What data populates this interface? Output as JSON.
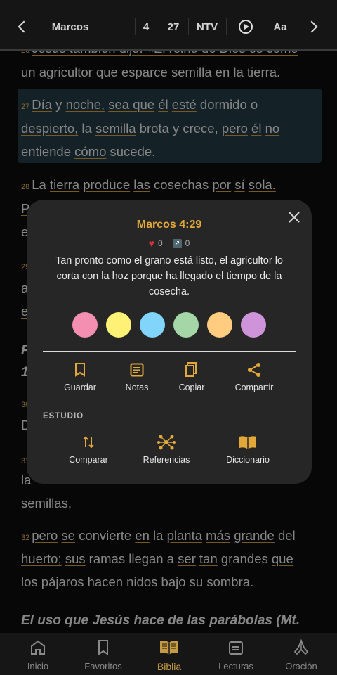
{
  "topbar": {
    "book": "Marcos",
    "chapter": "4",
    "count": "27",
    "version": "NTV",
    "font_label": "Aa"
  },
  "reader": {
    "v26_frag": "26",
    "v26_l1": "Jesús también dijo: «El reino de Dios es como",
    "v26_l2a": "un agricultor ",
    "v26_l2b": "que",
    "v26_l2c": " esparce ",
    "v26_l2d": "semilla",
    "v26_l2e": " ",
    "v26_l2f": "en",
    "v26_l2g": " la ",
    "v26_l2h": "tierra.",
    "v27_num": "27",
    "v27_w1": "Día",
    "v27_w2": " y ",
    "v27_w3": "noche,",
    "v27_w4": " ",
    "v27_w5": "sea que",
    "v27_w6": " ",
    "v27_w7": "él",
    "v27_w8": " ",
    "v27_w9": "esté",
    "v27_w10": " dormido o",
    "v27_l2a": "despierto,",
    "v27_l2b": " la ",
    "v27_l2c": "semilla",
    "v27_l2d": " brota y crece, ",
    "v27_l2e": "pero",
    "v27_l2f": " ",
    "v27_l2g": "él",
    "v27_l2h": " ",
    "v27_l2i": "no",
    "v27_l3a": "entiende ",
    "v27_l3b": "cómo",
    "v27_l3c": " sucede.",
    "v28_num": "28",
    "v28_w1": "La ",
    "v28_w2": "tierra",
    "v28_w3": " ",
    "v28_w4": "produce",
    "v28_w5": " ",
    "v28_w6": "las",
    "v28_w7": " cosechas ",
    "v28_w8": "por",
    "v28_w9": " ",
    "v28_w10": "sí",
    "v28_w11": " ",
    "v28_w12": "sola.",
    "v28_l2": "P",
    "v28_l3": "e",
    "v29_num": "29",
    "v29_l2": "a",
    "v29_l3": "e",
    "head1_l1": "P",
    "head1_l2": "1",
    "v30_num": "30",
    "v30_l2": "D",
    "v31_num": "31",
    "v31_end": "n",
    "v31_l2a": "la",
    "v31_l2b": "s",
    "v31_l3": "semillas,",
    "v32_num": "32",
    "v32_w1": "pero",
    "v32_w2": " ",
    "v32_w3": "se",
    "v32_w4": " convierte ",
    "v32_w5": "en",
    "v32_w6": " la ",
    "v32_w7": "planta",
    "v32_w8": " ",
    "v32_w9": "más",
    "v32_w10": " ",
    "v32_w11": "grande",
    "v32_w12": " del",
    "v32_l2a": "huerto;",
    "v32_l2b": " ",
    "v32_l2c": "sus",
    "v32_l2d": " ramas llegan a ",
    "v32_l2e": "ser",
    "v32_l2f": " ",
    "v32_l2g": "tan",
    "v32_l2h": " grandes ",
    "v32_l2i": "que",
    "v32_l3a": "los",
    "v32_l3b": " pájaros hacen nidos ",
    "v32_l3c": "bajo",
    "v32_l3d": " ",
    "v32_l3e": "su",
    "v32_l3f": " ",
    "v32_l3g": "sombra.",
    "heading2": "El uso que Jesús hace de las parábolas (Mt."
  },
  "popup": {
    "reference": "Marcos 4:29",
    "likes": "0",
    "shares": "0",
    "verse_text": "Tan pronto como el grano está listo, el agricultor lo corta con la hoz porque ha llegado el tiempo de la cosecha.",
    "colors": [
      "#f48fb1",
      "#fff176",
      "#81d4fa",
      "#a5d6a7",
      "#ffcc80",
      "#ce93d8"
    ],
    "actions": [
      "Guardar",
      "Notas",
      "Copiar",
      "Compartir"
    ],
    "study_label": "ESTUDIO",
    "study": [
      "Comparar",
      "Referencias",
      "Diccionario"
    ]
  },
  "nav": {
    "items": [
      "Inicio",
      "Favoritos",
      "Biblia",
      "Lecturas",
      "Oración"
    ],
    "active_color": "#c59a43"
  }
}
